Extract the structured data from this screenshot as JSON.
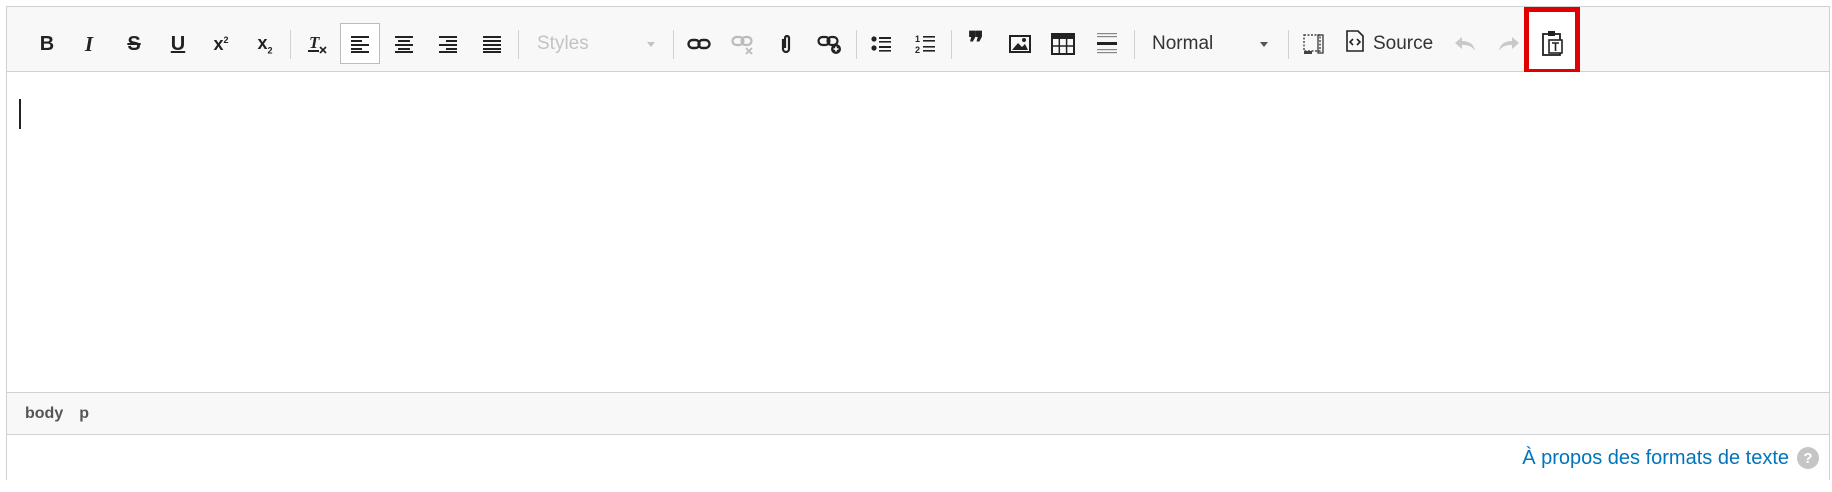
{
  "toolbar": {
    "styles_placeholder": "Styles",
    "format_value": "Normal",
    "source_label": "Source",
    "bold": "B",
    "italic": "I",
    "strike": "S",
    "underline": "U",
    "superscript": "x",
    "superscript_mark": "2",
    "subscript": "x",
    "subscript_mark": "2",
    "blockquote": "❞"
  },
  "pathbar": {
    "items": [
      "body",
      "p"
    ]
  },
  "footer": {
    "link": "À propos des formats de texte",
    "help": "?"
  },
  "colors": {
    "highlight": "#e00000",
    "link": "#0074bd",
    "toolbar_bg": "#f8f8f8",
    "border": "#d1d1d1"
  },
  "icons": [
    "bold-icon",
    "italic-icon",
    "strikethrough-icon",
    "underline-icon",
    "superscript-icon",
    "subscript-icon",
    "remove-format-icon",
    "align-left-icon",
    "align-center-icon",
    "align-right-icon",
    "justify-icon",
    "link-icon",
    "unlink-icon",
    "attachment-icon",
    "link-plus-icon",
    "bulleted-list-icon",
    "numbered-list-icon",
    "blockquote-icon",
    "image-icon",
    "table-icon",
    "horizontal-rule-icon",
    "maximize-icon",
    "source-icon",
    "undo-icon",
    "redo-icon",
    "paste-text-icon"
  ]
}
